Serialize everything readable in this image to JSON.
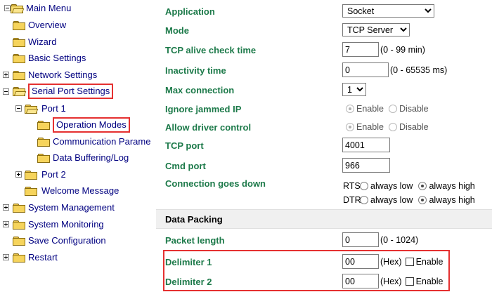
{
  "tree": {
    "main_menu": "Main Menu",
    "overview": "Overview",
    "wizard": "Wizard",
    "basic_settings": "Basic Settings",
    "network_settings": "Network Settings",
    "serial_port_settings": "Serial Port Settings",
    "port1": "Port 1",
    "operation_modes": "Operation Modes",
    "communication_params": "Communication Parame",
    "data_buffering": "Data Buffering/Log",
    "port2": "Port 2",
    "welcome_message": "Welcome Message",
    "system_management": "System Management",
    "system_monitoring": "System Monitoring",
    "save_configuration": "Save Configuration",
    "restart": "Restart"
  },
  "form": {
    "application": {
      "label": "Application",
      "value": "Socket"
    },
    "mode": {
      "label": "Mode",
      "value": "TCP Server"
    },
    "tcp_alive": {
      "label": "TCP alive check time",
      "value": "7",
      "hint": "(0 - 99 min)"
    },
    "inactivity": {
      "label": "Inactivity time",
      "value": "0",
      "hint": "(0 - 65535 ms)"
    },
    "max_connection": {
      "label": "Max connection",
      "value": "1"
    },
    "ignore_jammed": {
      "label": "Ignore jammed IP",
      "opt1": "Enable",
      "opt2": "Disable"
    },
    "allow_driver": {
      "label": "Allow driver control",
      "opt1": "Enable",
      "opt2": "Disable"
    },
    "tcp_port": {
      "label": "TCP port",
      "value": "4001"
    },
    "cmd_port": {
      "label": "Cmd port",
      "value": "966"
    },
    "conn_down": {
      "label": "Connection goes down",
      "rts": "RTS",
      "dtr": "DTR",
      "always_low": "always low",
      "always_high": "always high"
    },
    "data_packing": "Data Packing",
    "packet_length": {
      "label": "Packet length",
      "value": "0",
      "hint": "(0 - 1024)"
    },
    "delimiter1": {
      "label": "Delimiter 1",
      "value": "00",
      "unit": "(Hex)",
      "enable": "Enable"
    },
    "delimiter2": {
      "label": "Delimiter 2",
      "value": "00",
      "unit": "(Hex)",
      "enable": "Enable"
    }
  }
}
